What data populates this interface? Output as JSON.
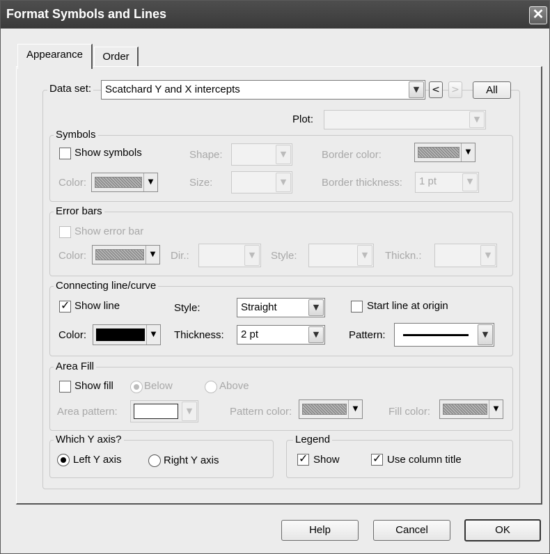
{
  "window": {
    "title": "Format Symbols and Lines",
    "close_glyph": "✕"
  },
  "tabs": [
    {
      "label": "Appearance",
      "active": true
    },
    {
      "label": "Order",
      "active": false
    }
  ],
  "dataset": {
    "label": "Data set:",
    "value": "Scatchard Y and X intercepts",
    "prev_glyph": "<",
    "next_glyph": ">",
    "all_label": "All"
  },
  "plot": {
    "label": "Plot:",
    "value": ""
  },
  "symbols": {
    "group_label": "Symbols",
    "show_label": "Show symbols",
    "show_checked": false,
    "shape_label": "Shape:",
    "shape_value": "",
    "border_color_label": "Border color:",
    "color_label": "Color:",
    "size_label": "Size:",
    "size_value": "",
    "border_thickness_label": "Border thickness:",
    "border_thickness_value": "1 pt"
  },
  "error_bars": {
    "group_label": "Error bars",
    "show_label": "Show error bar",
    "show_checked": false,
    "color_label": "Color:",
    "dir_label": "Dir.:",
    "dir_value": "",
    "style_label": "Style:",
    "style_value": "",
    "thickness_label": "Thickn.:",
    "thickness_value": ""
  },
  "connecting_line": {
    "group_label": "Connecting line/curve",
    "show_label": "Show line",
    "show_checked": true,
    "style_label": "Style:",
    "style_value": "Straight",
    "start_origin_label": "Start line at origin",
    "start_origin_checked": false,
    "color_label": "Color:",
    "color": "#000000",
    "thickness_label": "Thickness:",
    "thickness_value": "2 pt",
    "pattern_label": "Pattern:"
  },
  "area_fill": {
    "group_label": "Area Fill",
    "show_label": "Show fill",
    "show_checked": false,
    "below_label": "Below",
    "below_selected": true,
    "above_label": "Above",
    "above_selected": false,
    "area_pattern_label": "Area pattern:",
    "pattern_color_label": "Pattern color:",
    "fill_color_label": "Fill color:"
  },
  "which_y_axis": {
    "group_label": "Which Y axis?",
    "left_label": "Left Y axis",
    "left_selected": true,
    "right_label": "Right  Y axis",
    "right_selected": false
  },
  "legend": {
    "group_label": "Legend",
    "show_label": "Show",
    "show_checked": true,
    "use_column_title_label": "Use column title",
    "use_column_title_checked": true
  },
  "buttons": {
    "help": "Help",
    "cancel": "Cancel",
    "ok": "OK"
  },
  "glyphs": {
    "checkmark": "✓",
    "dropdown": "▼"
  }
}
